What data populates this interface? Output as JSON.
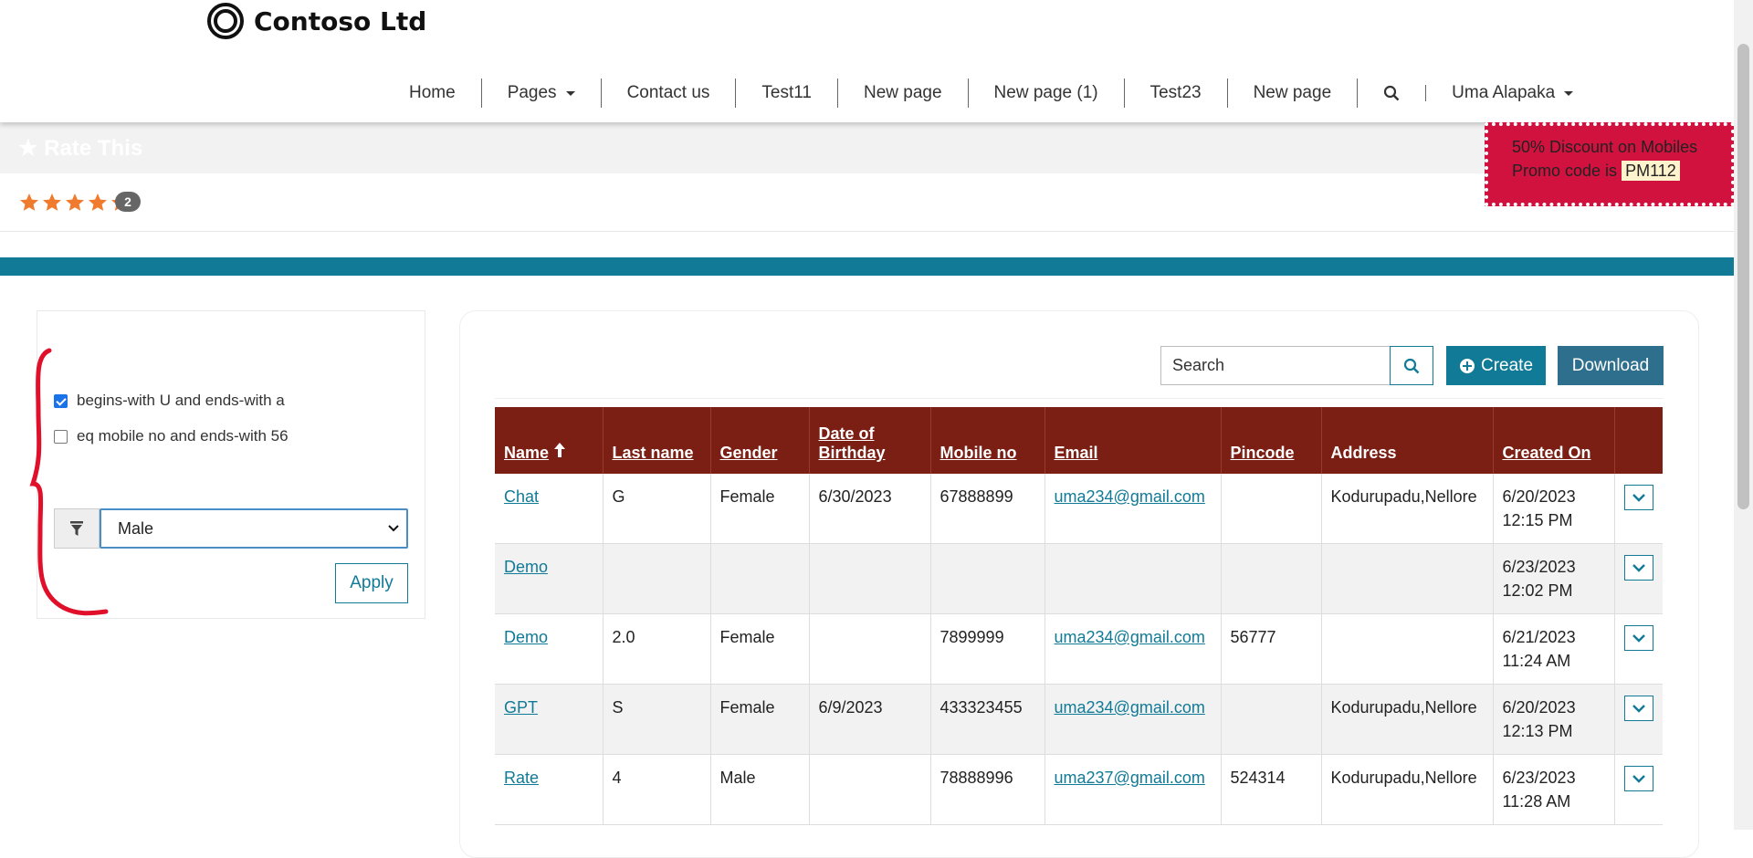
{
  "brand": {
    "name": "Contoso Ltd"
  },
  "nav": {
    "items": [
      {
        "label": "Home",
        "dropdown": false
      },
      {
        "label": "Pages",
        "dropdown": true
      },
      {
        "label": "Contact us",
        "dropdown": false
      },
      {
        "label": "Test11",
        "dropdown": false
      },
      {
        "label": "New page",
        "dropdown": false
      },
      {
        "label": "New page (1)",
        "dropdown": false
      },
      {
        "label": "Test23",
        "dropdown": false
      },
      {
        "label": "New page",
        "dropdown": false
      }
    ],
    "user": "Uma Alapaka"
  },
  "rate": {
    "title": "Rate This",
    "rating": 4.5,
    "count": "2"
  },
  "promo": {
    "line1": "50% Discount on Mobiles",
    "line2_prefix": "Promo code is",
    "code": "PM112"
  },
  "filter": {
    "options": [
      {
        "label": "begins-with U and ends-with a",
        "checked": true
      },
      {
        "label": "eq mobile no and ends-with 56",
        "checked": false
      }
    ],
    "select_value": "Male",
    "apply_label": "Apply"
  },
  "toolbar": {
    "search_placeholder": "Search",
    "create_label": "Create",
    "download_label": "Download"
  },
  "table": {
    "headers": [
      "Name",
      "Last name",
      "Gender",
      "Date of Birthday",
      "Mobile no",
      "Email",
      "Pincode",
      "Address",
      "Created On"
    ],
    "rows": [
      {
        "name": "Chat",
        "last": "G",
        "gender": "Female",
        "dob": "6/30/2023",
        "mobile": "67888899",
        "email": "uma234@gmail.com",
        "pincode": "",
        "address": "Kodurupadu,Nellore",
        "created_date": "6/20/2023",
        "created_time": "12:15 PM"
      },
      {
        "name": "Demo",
        "last": "",
        "gender": "",
        "dob": "",
        "mobile": "",
        "email": "",
        "pincode": "",
        "address": "",
        "created_date": "6/23/2023",
        "created_time": "12:02 PM"
      },
      {
        "name": "Demo",
        "last": "2.0",
        "gender": "Female",
        "dob": "",
        "mobile": "7899999",
        "email": "uma234@gmail.com",
        "pincode": "56777",
        "address": "",
        "created_date": "6/21/2023",
        "created_time": "11:24 AM"
      },
      {
        "name": "GPT",
        "last": "S",
        "gender": "Female",
        "dob": "6/9/2023",
        "mobile": "433323455",
        "email": "uma234@gmail.com",
        "pincode": "",
        "address": "Kodurupadu,Nellore",
        "created_date": "6/20/2023",
        "created_time": "12:13 PM"
      },
      {
        "name": "Rate",
        "last": "4",
        "gender": "Male",
        "dob": "",
        "mobile": "78888996",
        "email": "uma237@gmail.com",
        "pincode": "524314",
        "address": "Kodurupadu,Nellore",
        "created_date": "6/23/2023",
        "created_time": "11:28 AM"
      }
    ]
  },
  "colors": {
    "teal": "#117a96",
    "header_maroon": "#7b1f14",
    "promo_red": "#d1123f",
    "annotation_red": "#e0102a"
  }
}
